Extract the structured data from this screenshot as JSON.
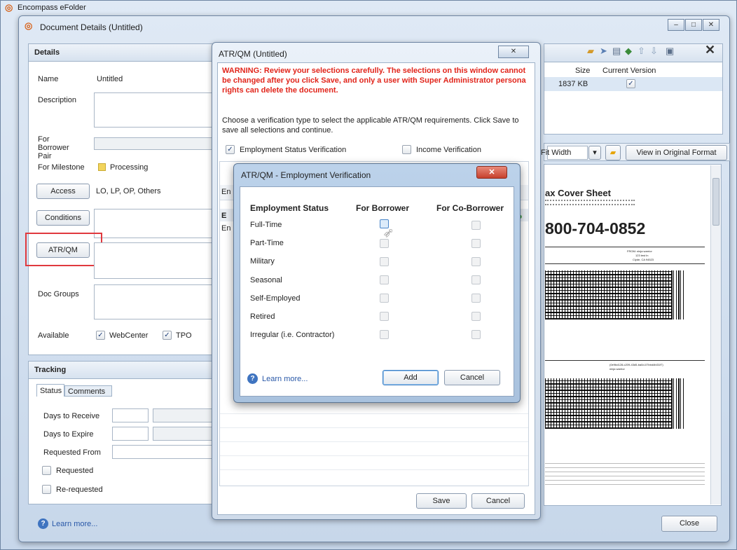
{
  "app": {
    "outer_title": "Encompass eFolder",
    "window_title": "Document Details (Untitled)",
    "window_controls": [
      "–",
      "□",
      "✕"
    ]
  },
  "details": {
    "header": "Details",
    "name_label": "Name",
    "name_value": "Untitled",
    "description_label": "Description",
    "for_borrower_pair_label": "For Borrower Pair",
    "for_milestone_label": "For Milestone",
    "milestone_value": "Processing",
    "access_button": "Access",
    "access_value": "LO, LP, OP, Others",
    "conditions_button": "Conditions",
    "atrqm_button": "ATR/QM",
    "doc_groups_label": "Doc Groups",
    "available_label": "Available",
    "available_options": [
      {
        "label": "WebCenter",
        "checked": true
      },
      {
        "label": "TPO",
        "checked": true
      }
    ]
  },
  "tracking": {
    "header": "Tracking",
    "tabs": [
      "Status",
      "Comments"
    ],
    "days_to_receive_label": "Days to Receive",
    "days_to_expire_label": "Days to Expire",
    "requested_from_label": "Requested From",
    "requested_label": "Requested",
    "rerequested_label": "Re-requested"
  },
  "files": {
    "size_header": "Size",
    "current_version_header": "Current Version",
    "row_size": "1837 KB",
    "row_current_checked": true
  },
  "viewer": {
    "zoom_value": "Fit Width",
    "view_original_button": "View in Original Format",
    "doc_title": "ax Cover Sheet",
    "doc_phone": "800-704-0852",
    "doc_small_1": "FROM: ninja warrior",
    "doc_small_2": "123 test ln",
    "doc_small_3": "Clyde, CA 94523",
    "doc_small_4": "(0e9bd128-c209-43d5-ba0d-07bbd4fd31f7)",
    "doc_small_5": "ninja warrior"
  },
  "bottom": {
    "learn_more": "Learn more...",
    "close_button": "Close"
  },
  "atrqm_dialog": {
    "title": "ATR/QM (Untitled)",
    "warning": "WARNING: Review your selections carefully. The selections on this window cannot be changed after you click Save, and only a user with Super Administrator persona rights can delete the document.",
    "instruction": "Choose a verification type to select the applicable ATR/QM requirements. Click Save to save all selections and continue.",
    "employment_status_verification_label": "Employment Status Verification",
    "employment_status_verification_checked": true,
    "income_verification_label": "Income Verification",
    "income_verification_checked": false,
    "save_button": "Save",
    "cancel_button": "Cancel",
    "grid_fragments": [
      "En",
      "E",
      "En"
    ]
  },
  "emp_dialog": {
    "title": "ATR/QM - Employment Verification",
    "col_status": "Employment Status",
    "col_borrower": "For Borrower",
    "col_coborrower": "For Co-Borrower",
    "rows": [
      {
        "label": "Full-Time"
      },
      {
        "label": "Part-Time"
      },
      {
        "label": "Military"
      },
      {
        "label": "Seasonal"
      },
      {
        "label": "Self-Employed"
      },
      {
        "label": "Retired"
      },
      {
        "label": "Irregular (i.e. Contractor)"
      }
    ],
    "learn_more": "Learn more...",
    "add_button": "Add",
    "cancel_button": "Cancel"
  },
  "colors": {
    "warning_red": "#e1251b",
    "highlight_box": "#e0393e",
    "title_blue": "#1f3f7a"
  }
}
